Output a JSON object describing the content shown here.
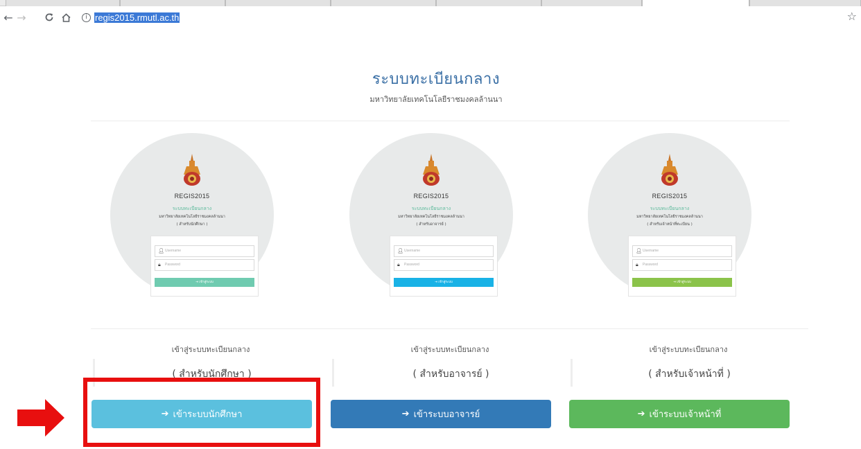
{
  "browser": {
    "url": "regis2015.rmutl.ac.th",
    "back_icon": "arrow-left-icon",
    "forward_icon": "arrow-right-icon",
    "reload_icon": "reload-icon",
    "home_icon": "home-icon",
    "info_icon": "info-icon",
    "bookmark_icon": "star-icon"
  },
  "page": {
    "title": "ระบบทะเบียนกลาง",
    "subtitle": "มหาวิทยาลัยเทคโนโลยีราชมงคลล้านนา"
  },
  "columns": [
    {
      "card": {
        "brand": "REGIS2015",
        "system": "ระบบทะเบียนกลาง",
        "university": "มหาวิทยาลัยเทคโนโลยีราชมงคลล้านนา",
        "role": "( สำหรับนักศึกษา )",
        "username_placeholder": "Username",
        "password_placeholder": "Password",
        "button": "เข้าสู่ระบบ",
        "accent": "#6fcbb0"
      },
      "enter_text": "เข้าสู่ระบบทะเบียนกลาง",
      "role_text": "( สำหรับนักศึกษา )",
      "button_label": "เข้าระบบนักศึกษา",
      "button_color": "#5bc0de"
    },
    {
      "card": {
        "brand": "REGIS2015",
        "system": "ระบบทะเบียนกลาง",
        "university": "มหาวิทยาลัยเทคโนโลยีราชมงคลล้านนา",
        "role": "( สำหรับอาจารย์ )",
        "username_placeholder": "Username",
        "password_placeholder": "Password",
        "button": "เข้าสู่ระบบ",
        "accent": "#19b2e6"
      },
      "enter_text": "เข้าสู่ระบบทะเบียนกลาง",
      "role_text": "( สำหรับอาจารย์ )",
      "button_label": "เข้าระบบอาจารย์",
      "button_color": "#337ab7"
    },
    {
      "card": {
        "brand": "REGIS2015",
        "system": "ระบบทะเบียนกลาง",
        "university": "มหาวิทยาลัยเทคโนโลยีราชมงคลล้านนา",
        "role": "( สำหรับเจ้าหน้าที่ทะเบียน )",
        "username_placeholder": "Username",
        "password_placeholder": "Password",
        "button": "เข้าสู่ระบบ",
        "accent": "#8bc34a"
      },
      "enter_text": "เข้าสู่ระบบทะเบียนกลาง",
      "role_text": "( สำหรับเจ้าหน้าที่ )",
      "button_label": "เข้าระบบเจ้าหน้าที่",
      "button_color": "#5cb85c"
    }
  ],
  "annotation": {
    "highlight_color": "#e80f0f"
  }
}
